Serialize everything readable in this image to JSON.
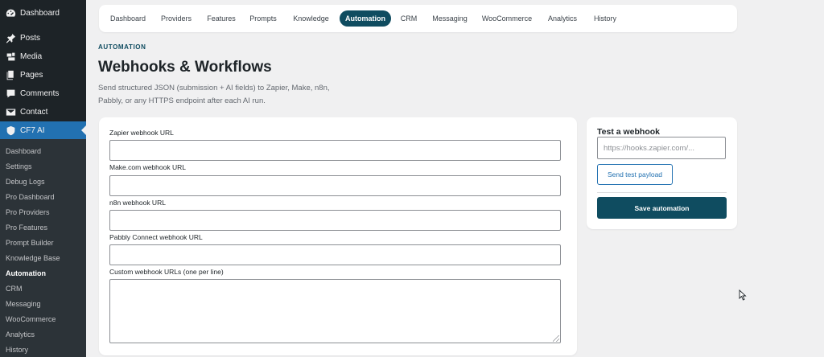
{
  "sidebar": {
    "menu": [
      {
        "label": "Dashboard",
        "icon": "dashboard-icon"
      },
      {
        "label": "Posts",
        "icon": "pin-icon"
      },
      {
        "label": "Media",
        "icon": "media-icon"
      },
      {
        "label": "Pages",
        "icon": "pages-icon"
      },
      {
        "label": "Comments",
        "icon": "comments-icon"
      },
      {
        "label": "Contact",
        "icon": "mail-icon"
      },
      {
        "label": "CF7 AI",
        "icon": "shield-icon"
      }
    ],
    "submenu": [
      "Dashboard",
      "Settings",
      "Debug Logs",
      "Pro Dashboard",
      "Pro Providers",
      "Pro Features",
      "Prompt Builder",
      "Knowledge Base",
      "Automation",
      "CRM",
      "Messaging",
      "WooCommerce",
      "Analytics",
      "History"
    ],
    "current_submenu": "Automation",
    "colors": {
      "background": "#1d2327",
      "active": "#2271b1",
      "submenu_bg": "#2c3338"
    }
  },
  "tabs": [
    "Dashboard",
    "Providers",
    "Features",
    "Prompts",
    "Knowledge",
    "Automation",
    "CRM",
    "Messaging",
    "WooCommerce",
    "Analytics",
    "History"
  ],
  "active_tab": "Automation",
  "header": {
    "eyebrow": "AUTOMATION",
    "title": "Webhooks & Workflows",
    "description_line1": "Send structured JSON (submission + AI fields) to Zapier, Make, n8n,",
    "description_line2": "Pabbly, or any HTTPS endpoint after each AI run."
  },
  "form": {
    "zapier_label": "Zapier webhook URL",
    "zapier_value": "",
    "make_label": "Make.com webhook URL",
    "make_value": "",
    "n8n_label": "n8n webhook URL",
    "n8n_value": "",
    "pabbly_label": "Pabbly Connect webhook URL",
    "pabbly_value": "",
    "custom_label": "Custom webhook URLs (one per line)",
    "custom_value": ""
  },
  "test_panel": {
    "title": "Test a webhook",
    "url_placeholder": "https://hooks.zapier.com/...",
    "send_label": "Send test payload",
    "save_label": "Save automation"
  },
  "accent_color": "#0f4c60"
}
